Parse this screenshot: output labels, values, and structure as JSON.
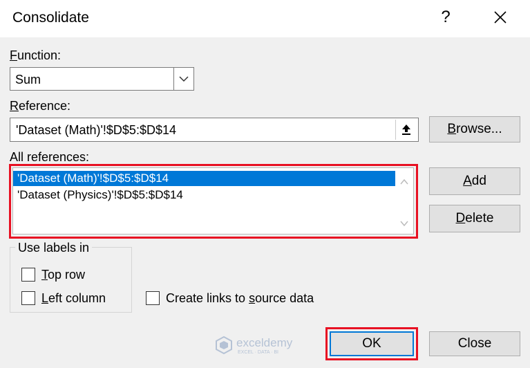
{
  "window": {
    "title": "Consolidate"
  },
  "function": {
    "label": "Function:",
    "value": "Sum"
  },
  "reference": {
    "label": "Reference:",
    "value": "'Dataset (Math)'!$D$5:$D$14",
    "browse_label": "Browse..."
  },
  "all_references": {
    "label": "All references:",
    "items": [
      "'Dataset (Math)'!$D$5:$D$14",
      "'Dataset (Physics)'!$D$5:$D$14"
    ],
    "selected_index": 0
  },
  "buttons": {
    "add": "Add",
    "delete": "Delete",
    "ok": "OK",
    "close": "Close"
  },
  "use_labels": {
    "title": "Use labels in",
    "top_row": "Top row",
    "left_column": "Left column"
  },
  "create_links": "Create links to source data",
  "watermark": {
    "name": "exceldemy",
    "tagline": "EXCEL · DATA · BI"
  },
  "colors": {
    "highlight": "#e81123",
    "selection": "#0078d7",
    "ok_border": "#0078d7"
  }
}
